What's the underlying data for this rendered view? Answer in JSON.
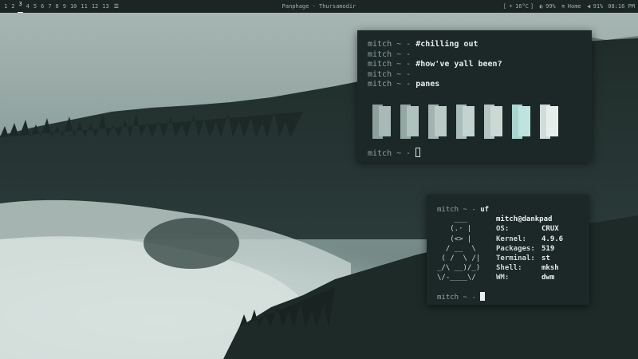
{
  "topbar": {
    "workspaces": [
      "1",
      "2",
      "3",
      "4",
      "5",
      "6",
      "7",
      "8",
      "9",
      "10",
      "11",
      "12",
      "13"
    ],
    "active_workspace": "3",
    "layout_symbol": "☰",
    "window_title": "Panphage - Thursamodir",
    "status": {
      "temperature_label": "16°C",
      "brightness_label": "99%",
      "network_label": "Home",
      "volume_label": "91%",
      "clock": "08:16 PM"
    }
  },
  "terminal1": {
    "lines": [
      {
        "user": "mitch ~",
        "command": "#chilling out"
      },
      {
        "user": "mitch ~",
        "command": ""
      },
      {
        "user": "mitch ~",
        "command": "#how've yall been?"
      },
      {
        "user": "mitch ~",
        "command": ""
      },
      {
        "user": "mitch ~",
        "command": "panes"
      }
    ],
    "pane_colors": [
      {
        "back": "#8ea09b",
        "front": "#a9b9b5"
      },
      {
        "back": "#93a8a3",
        "front": "#afc2bd"
      },
      {
        "back": "#a3b3af",
        "front": "#bccac6"
      },
      {
        "back": "#a9bdb8",
        "front": "#c3d3cf"
      },
      {
        "back": "#b5c6c2",
        "front": "#cbd9d5"
      },
      {
        "back": "#a7d6d1",
        "front": "#bfe4e0"
      },
      {
        "back": "#cfdcd9",
        "front": "#e6eeec"
      }
    ],
    "final_prompt": "mitch ~"
  },
  "terminal2": {
    "prompt_user": "mitch ~",
    "command": "uf",
    "ascii_art": [
      "    ___",
      "   (.· |",
      "   (<> |",
      "  / __  \\",
      " ( /  \\ /|",
      "_/\\ __)/_)",
      "\\/-____\\/"
    ],
    "host": "mitch@dankpad",
    "info": [
      {
        "key": "OS:",
        "value": "CRUX"
      },
      {
        "key": "Kernel:",
        "value": "4.9.6"
      },
      {
        "key": "Packages:",
        "value": "519"
      },
      {
        "key": "Terminal:",
        "value": "st"
      },
      {
        "key": "Shell:",
        "value": "mksh"
      },
      {
        "key": "WM:",
        "value": "dwm"
      }
    ],
    "final_prompt": "mitch ~"
  }
}
